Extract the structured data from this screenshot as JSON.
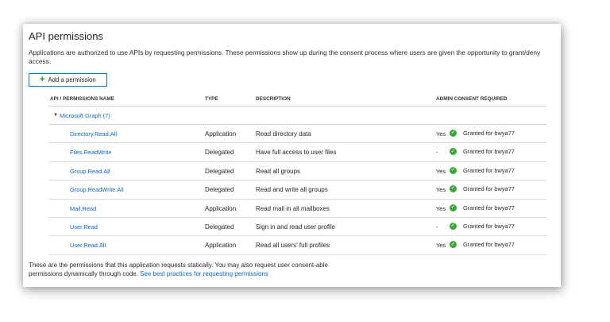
{
  "page": {
    "title": "API permissions",
    "intro": "Applications are authorized to use APIs by requesting permissions. These permissions show up during the consent process where users are given the opportunity to grant/deny access.",
    "add_button_label": "Add a permission"
  },
  "table": {
    "headers": {
      "name": "API / PERMISSIONS NAME",
      "type": "TYPE",
      "description": "DESCRIPTION",
      "admin": "ADMIN CONSENT REQUIRED"
    },
    "group_label": "Microsoft Graph (7)",
    "rows": [
      {
        "name": "Directory.Read.All",
        "type": "Application",
        "description": "Read directory data",
        "admin": "Yes",
        "status": "Granted for bwya77"
      },
      {
        "name": "Files.ReadWrite",
        "type": "Delegated",
        "description": "Have full access to user files",
        "admin": "-",
        "status": "Granted for bwya77"
      },
      {
        "name": "Group.Read.All",
        "type": "Delegated",
        "description": "Read all groups",
        "admin": "Yes",
        "status": "Granted for bwya77"
      },
      {
        "name": "Group.ReadWrite.All",
        "type": "Delegated",
        "description": "Read and write all groups",
        "admin": "Yes",
        "status": "Granted for bwya77"
      },
      {
        "name": "Mail.Read",
        "type": "Application",
        "description": "Read mail in all mailboxes",
        "admin": "Yes",
        "status": "Granted for bwya77"
      },
      {
        "name": "User.Read",
        "type": "Delegated",
        "description": "Sign in and read user profile",
        "admin": "-",
        "status": "Granted for bwya77"
      },
      {
        "name": "User.Read.All",
        "type": "Application",
        "description": "Read all users' full profiles",
        "admin": "Yes",
        "status": "Granted for bwya77"
      }
    ]
  },
  "footer": {
    "text": "These are the permissions that this application requests statically. You may also request user consent-able permissions dynamically through code.",
    "link": "See best practices for requesting permissions"
  },
  "icons": {
    "add": "plus-icon",
    "expand": "caret-down-icon",
    "granted": "check-circle-icon"
  },
  "colors": {
    "accent": "#0078d4",
    "link": "#0b64c0",
    "granted": "#3ca83c"
  }
}
